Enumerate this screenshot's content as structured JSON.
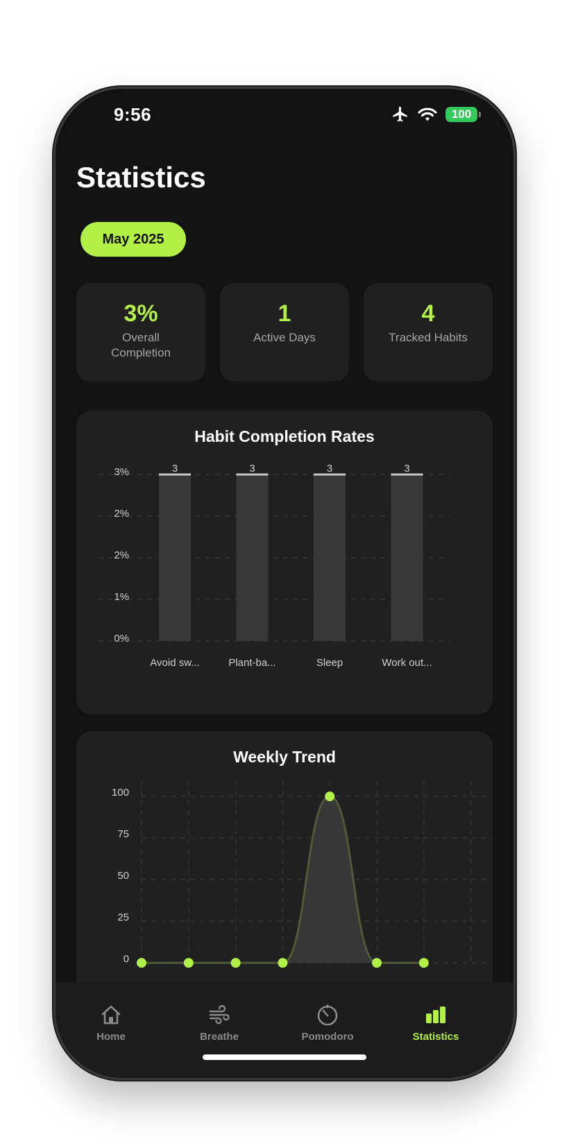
{
  "status_bar": {
    "time": "9:56",
    "battery": "100"
  },
  "page": {
    "title": "Statistics",
    "month": "May 2025"
  },
  "stats": [
    {
      "value": "3%",
      "label": "Overall Completion"
    },
    {
      "value": "1",
      "label": "Active Days"
    },
    {
      "value": "4",
      "label": "Tracked Habits"
    }
  ],
  "colors": {
    "accent": "#b3f047",
    "card": "#202020",
    "background": "#121212",
    "bar": "#383838"
  },
  "chart_data": [
    {
      "type": "bar",
      "title": "Habit Completion Rates",
      "categories": [
        "Avoid sw...",
        "Plant-ba...",
        "Sleep",
        "Work out..."
      ],
      "values": [
        3,
        3,
        3,
        3
      ],
      "data_labels": [
        "3",
        "3",
        "3",
        "3"
      ],
      "y_ticks": [
        "0%",
        "1%",
        "2%",
        "2%",
        "3%"
      ],
      "ylim": [
        0,
        3
      ],
      "grid": true
    },
    {
      "type": "area",
      "title": "Weekly Trend",
      "x_count": 7,
      "values": [
        0,
        0,
        0,
        0,
        100,
        0,
        0
      ],
      "y_ticks": [
        "0",
        "25",
        "50",
        "75",
        "100"
      ],
      "ylim": [
        0,
        100
      ],
      "grid": true
    }
  ],
  "tabs": [
    {
      "label": "Home",
      "icon": "home-icon",
      "active": false
    },
    {
      "label": "Breathe",
      "icon": "wind-icon",
      "active": false
    },
    {
      "label": "Pomodoro",
      "icon": "timer-icon",
      "active": false
    },
    {
      "label": "Statistics",
      "icon": "bar-chart-icon",
      "active": true
    }
  ]
}
